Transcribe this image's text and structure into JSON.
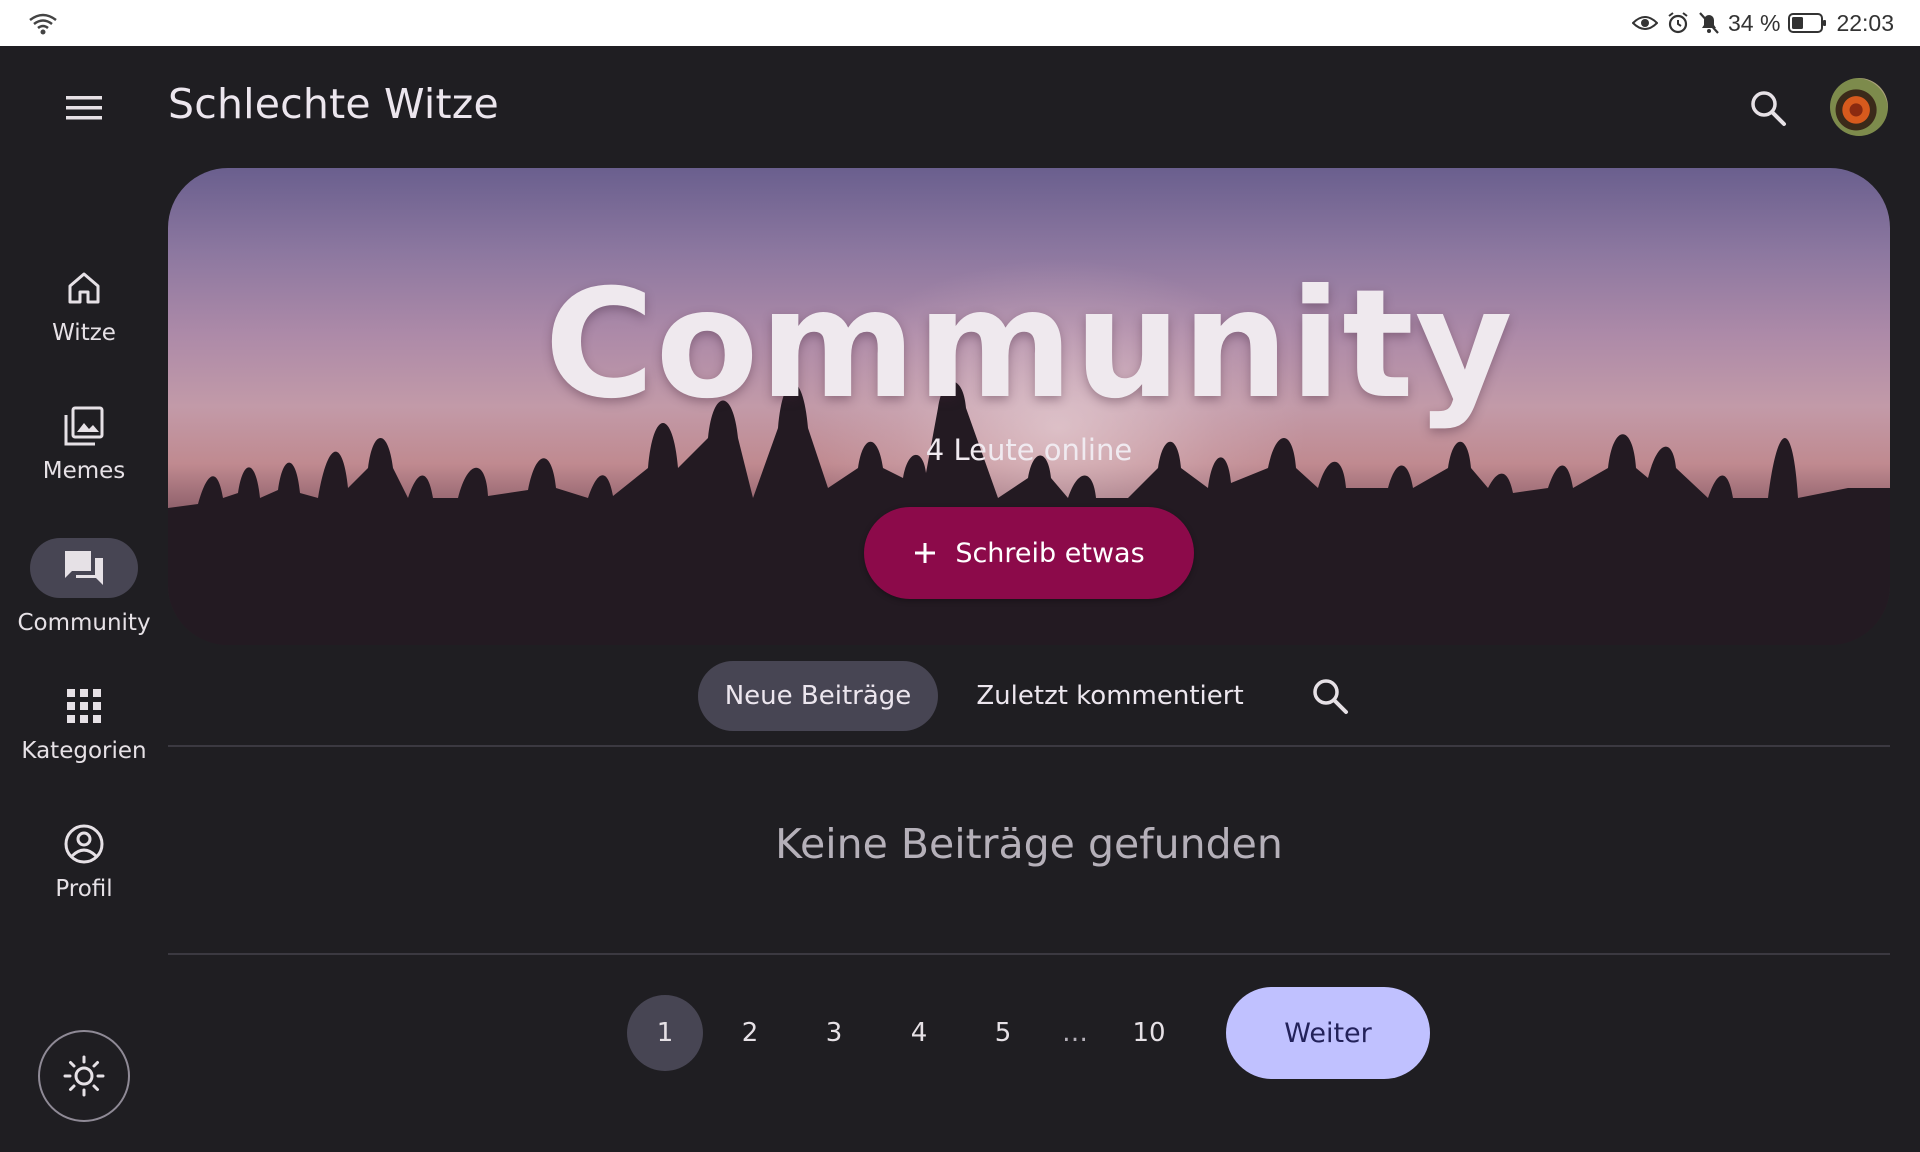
{
  "status_bar": {
    "battery": "34 %",
    "time": "22:03"
  },
  "app_bar": {
    "title": "Schlechte Witze"
  },
  "nav": {
    "items": [
      {
        "label": "Witze",
        "icon": "home-icon"
      },
      {
        "label": "Memes",
        "icon": "photo-library-icon"
      },
      {
        "label": "Community",
        "icon": "forum-icon",
        "active": true
      },
      {
        "label": "Kategorien",
        "icon": "apps-grid-icon"
      },
      {
        "label": "Profil",
        "icon": "account-circle-icon"
      }
    ]
  },
  "hero": {
    "title": "Community",
    "online": "4 Leute online",
    "write_button": "Schreib etwas"
  },
  "tabs": {
    "new_posts": "Neue Beiträge",
    "recently_commented": "Zuletzt kommentiert"
  },
  "empty_state": "Keine Beiträge gefunden",
  "pagination": {
    "pages": [
      "1",
      "2",
      "3",
      "4",
      "5"
    ],
    "ellipsis": "…",
    "last": "10",
    "current": "1",
    "next": "Weiter"
  },
  "colors": {
    "background": "#1f1e22",
    "accent_button": "#8c0a4a",
    "active_pill": "#474553",
    "next_button": "#c0c1ff"
  }
}
